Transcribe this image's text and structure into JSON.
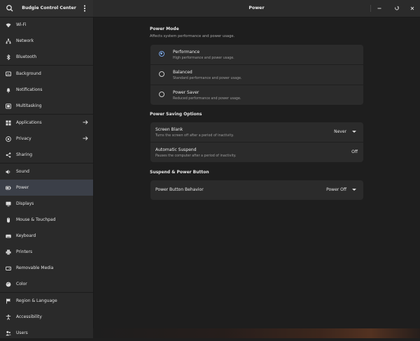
{
  "app": {
    "sidebar_title": "Budgie Control Center",
    "page_title": "Power"
  },
  "sidebar": {
    "items": [
      {
        "label": "Wi-Fi",
        "icon": "wifi-icon"
      },
      {
        "label": "Network",
        "icon": "network-icon"
      },
      {
        "label": "Bluetooth",
        "icon": "bluetooth-icon"
      },
      {
        "label": "Background",
        "icon": "background-icon"
      },
      {
        "label": "Notifications",
        "icon": "bell-icon"
      },
      {
        "label": "Multitasking",
        "icon": "multitasking-icon"
      },
      {
        "label": "Applications",
        "icon": "applications-icon",
        "has_arrow": true
      },
      {
        "label": "Privacy",
        "icon": "privacy-icon",
        "has_arrow": true
      },
      {
        "label": "Sharing",
        "icon": "share-icon"
      },
      {
        "label": "Sound",
        "icon": "speaker-icon"
      },
      {
        "label": "Power",
        "icon": "power-icon",
        "active": true
      },
      {
        "label": "Displays",
        "icon": "display-icon"
      },
      {
        "label": "Mouse & Touchpad",
        "icon": "mouse-icon"
      },
      {
        "label": "Keyboard",
        "icon": "keyboard-icon"
      },
      {
        "label": "Printers",
        "icon": "printer-icon"
      },
      {
        "label": "Removable Media",
        "icon": "removable-media-icon"
      },
      {
        "label": "Color",
        "icon": "color-icon"
      },
      {
        "label": "Region & Language",
        "icon": "flag-icon"
      },
      {
        "label": "Accessibility",
        "icon": "accessibility-icon"
      },
      {
        "label": "Users",
        "icon": "users-icon"
      }
    ]
  },
  "power_mode": {
    "title": "Power Mode",
    "subtitle": "Affects system performance and power usage.",
    "options": [
      {
        "label": "Performance",
        "desc": "High performance and power usage.",
        "selected": true
      },
      {
        "label": "Balanced",
        "desc": "Standard performance and power usage.",
        "selected": false
      },
      {
        "label": "Power Saver",
        "desc": "Reduced performance and power usage.",
        "selected": false
      }
    ]
  },
  "power_saving": {
    "title": "Power Saving Options",
    "screen_blank": {
      "label": "Screen Blank",
      "desc": "Turns the screen off after a period of inactivity.",
      "value": "Never"
    },
    "auto_suspend": {
      "label": "Automatic Suspend",
      "desc": "Pauses the computer after a period of inactivity.",
      "value": "Off"
    }
  },
  "suspend": {
    "title": "Suspend & Power Button",
    "power_button": {
      "label": "Power Button Behavior",
      "value": "Power Off"
    }
  },
  "colors": {
    "accent": "#7aa6e8",
    "active_row": "#3b3f48"
  }
}
